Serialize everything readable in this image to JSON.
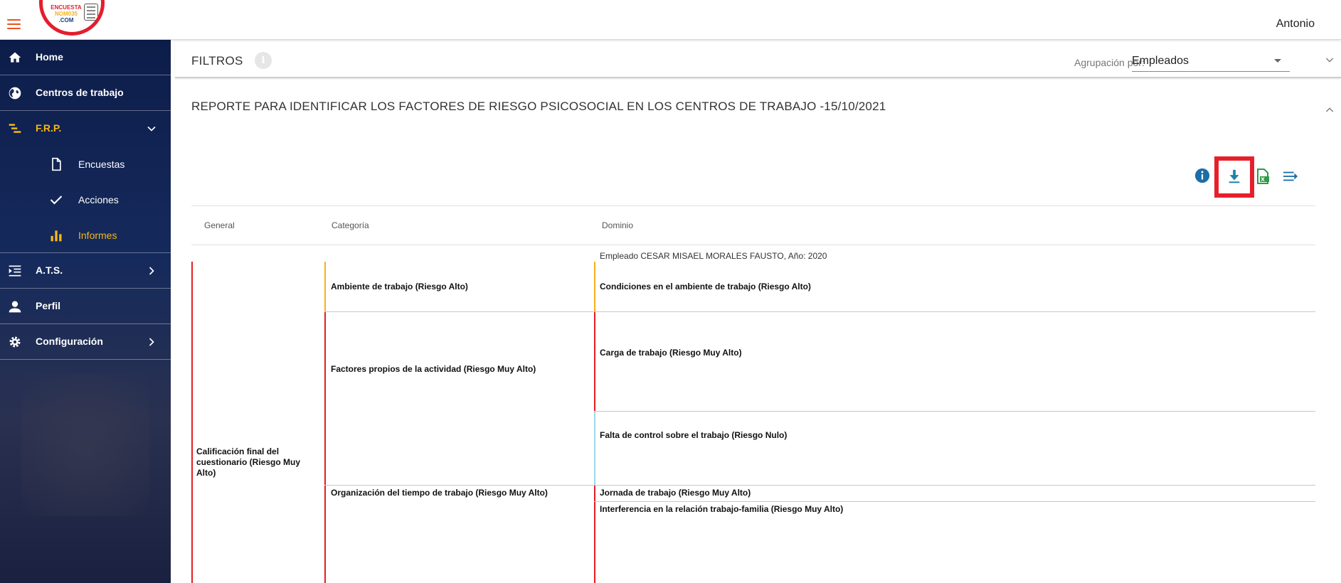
{
  "header": {
    "logo": {
      "line1": "ENCUESTA",
      "line2": "NOM035",
      "line3": ".COM"
    },
    "user": "Antonio"
  },
  "sidebar": {
    "items": [
      {
        "label": "Home",
        "icon": "home-icon"
      },
      {
        "label": "Centros de trabajo",
        "icon": "globe-icon"
      },
      {
        "label": "F.R.P.",
        "icon": "bars-icon"
      },
      {
        "label": "Encuestas",
        "icon": "document-icon"
      },
      {
        "label": "Acciones",
        "icon": "check-icon"
      },
      {
        "label": "Informes",
        "icon": "chart-icon"
      },
      {
        "label": "A.T.S.",
        "icon": "list-icon"
      },
      {
        "label": "Perfil",
        "icon": "person-icon"
      },
      {
        "label": "Configuración",
        "icon": "gear-icon"
      }
    ],
    "active_color": "#f6b718"
  },
  "filters": {
    "title": "FILTROS",
    "info": "i",
    "group_label": "Agrupación por:",
    "group_value": "Empleados"
  },
  "report": {
    "title": "REPORTE PARA IDENTIFICAR LOS FACTORES DE RIESGO PSICOSOCIAL EN LOS CENTROS DE TRABAJO -15/10/2021",
    "tools": [
      "info-icon",
      "download-icon",
      "excel-icon",
      "expand-lines-icon"
    ]
  },
  "table": {
    "headers": [
      "General",
      "Categoría",
      "Dominio"
    ],
    "employee_label": "Empleado CESAR MISAEL MORALES FAUSTO, Año: 2020",
    "general": "Calificación final del cuestionario (Riesgo Muy Alto)",
    "categories": [
      "Ambiente de trabajo (Riesgo Alto)",
      "Factores propios de la actividad (Riesgo Muy Alto)",
      "Organización del tiempo de trabajo (Riesgo Muy Alto)"
    ],
    "domains": [
      "Condiciones en el ambiente de trabajo (Riesgo Alto)",
      "Carga de trabajo (Riesgo Muy Alto)",
      "Falta de control sobre el trabajo (Riesgo Nulo)",
      "Jornada de trabajo (Riesgo Muy Alto)",
      "Interferencia en la relación trabajo-familia (Riesgo Muy Alto)"
    ],
    "risk_colors": {
      "muy_alto": "#e31e24",
      "alto": "#f5b21c",
      "nulo": "#9ed8ea"
    }
  }
}
